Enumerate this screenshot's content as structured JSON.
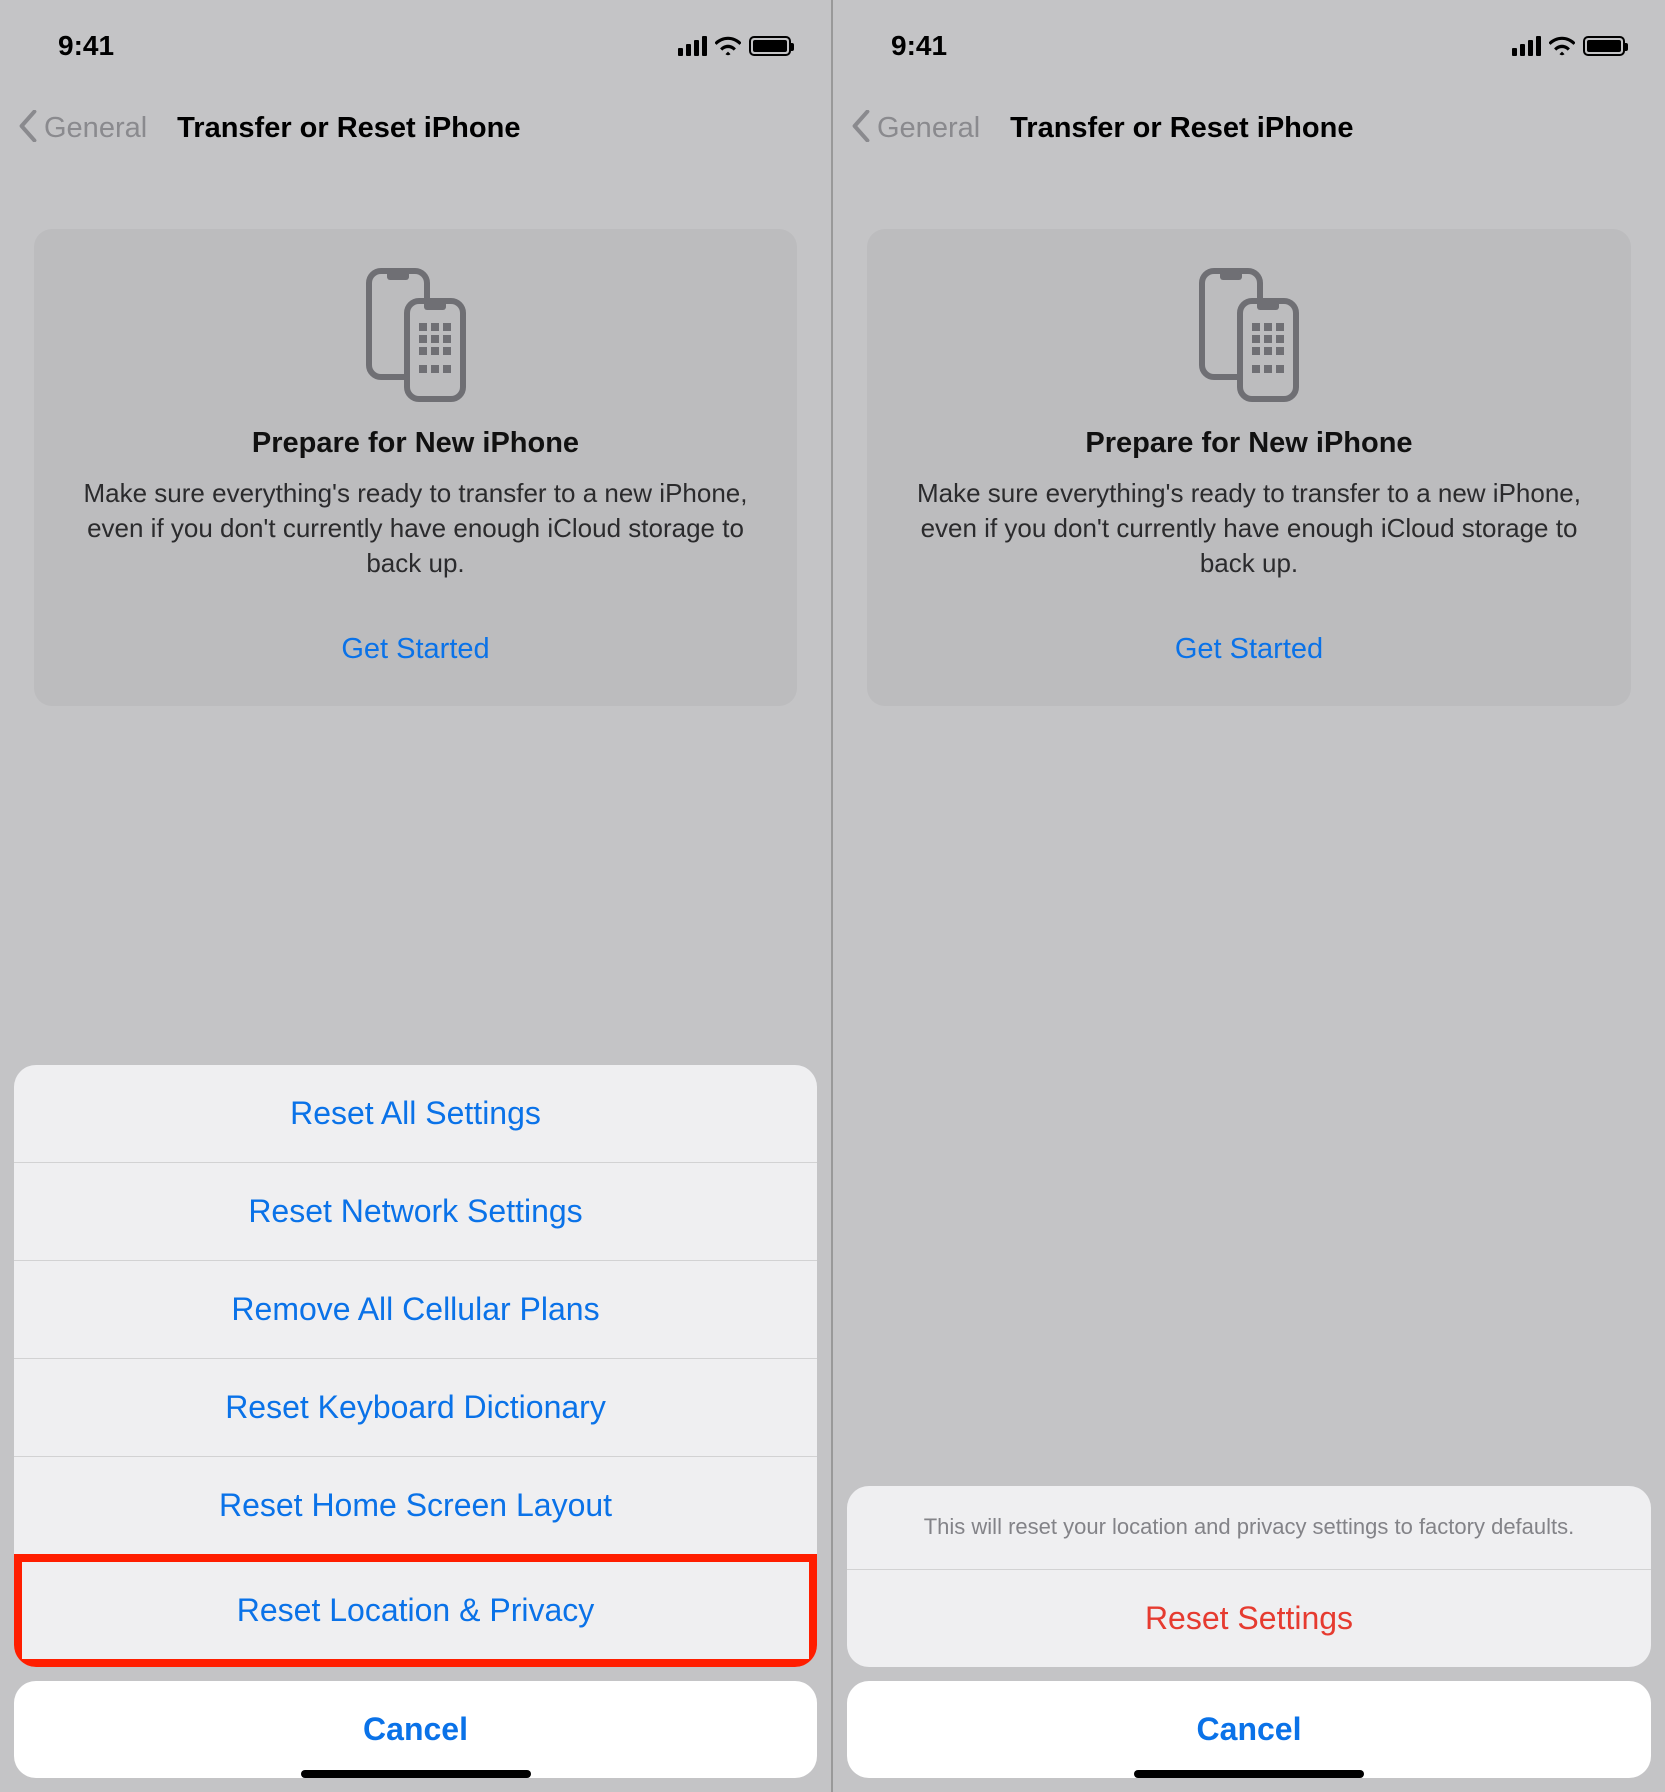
{
  "status": {
    "time": "9:41"
  },
  "nav": {
    "back": "General",
    "title": "Transfer or Reset iPhone"
  },
  "card": {
    "title": "Prepare for New iPhone",
    "desc": "Make sure everything's ready to transfer to a new iPhone, even if you don't currently have enough iCloud storage to back up.",
    "cta": "Get Started"
  },
  "left_sheet": {
    "items": [
      "Reset All Settings",
      "Reset Network Settings",
      "Remove All Cellular Plans",
      "Reset Keyboard Dictionary",
      "Reset Home Screen Layout",
      "Reset Location & Privacy"
    ],
    "cancel": "Cancel"
  },
  "right_sheet": {
    "info": "This will reset your location and privacy settings to factory defaults.",
    "action": "Reset Settings",
    "cancel": "Cancel"
  },
  "colors": {
    "accent": "#0a72e8",
    "danger": "#e63b30"
  }
}
